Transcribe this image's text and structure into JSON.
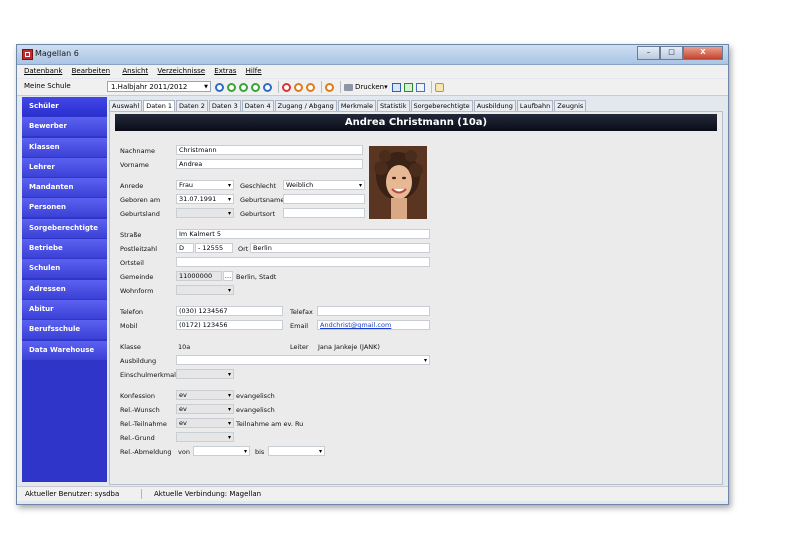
{
  "window": {
    "title": "Magellan 6",
    "controls": [
      "–",
      "□",
      "X"
    ]
  },
  "menu": [
    "Datenbank",
    "Bearbeiten",
    "Ansicht",
    "Verzeichnisse",
    "Extras",
    "Hilfe"
  ],
  "toolbar": {
    "school": "Meine Schule",
    "period": "1.Halbjahr 2011/2012",
    "print_label": "Drucken"
  },
  "sidebar": [
    "Schüler",
    "Bewerber",
    "Klassen",
    "Lehrer",
    "Mandanten",
    "Personen",
    "Sorgeberechtigte",
    "Betriebe",
    "Schulen",
    "Adressen",
    "Abitur",
    "Berufsschule",
    "Data Warehouse"
  ],
  "tabs": [
    "Auswahl",
    "Daten 1",
    "Daten 2",
    "Daten 3",
    "Daten 4",
    "Zugang / Abgang",
    "Merkmale",
    "Statistik",
    "Sorgeberechtigte",
    "Ausbildung",
    "Laufbahn",
    "Zeugnis"
  ],
  "header": "Andrea Christmann (10a)",
  "labels": {
    "nachname": "Nachname",
    "vorname": "Vorname",
    "anrede": "Anrede",
    "geschlecht": "Geschlecht",
    "geboren": "Geboren am",
    "geburtsname": "Geburtsname",
    "geburtsland": "Geburtsland",
    "geburtsort": "Geburtsort",
    "strasse": "Straße",
    "plz": "Postleitzahl",
    "ort": "Ort",
    "ortsteil": "Ortsteil",
    "gemeinde": "Gemeinde",
    "wohnform": "Wohnform",
    "telefon": "Telefon",
    "telefax": "Telefax",
    "mobil": "Mobil",
    "email": "Email",
    "klasse": "Klasse",
    "leiter": "Leiter",
    "ausbildung": "Ausbildung",
    "einschul": "Einschulmerkmal",
    "konfession": "Konfession",
    "relwunsch": "Rel.-Wunsch",
    "relteil": "Rel.-Teilnahme",
    "relgrund": "Rel.-Grund",
    "relabm": "Rel.-Abmeldung",
    "von": "von",
    "bis": "bis"
  },
  "values": {
    "nachname": "Christmann",
    "vorname": "Andrea",
    "anrede": "Frau",
    "geschlecht": "Weiblich",
    "geboren": "31.07.1991",
    "strasse": "Im Kalmert 5",
    "plz_country": "D",
    "plz": "- 12555",
    "ort": "Berlin",
    "gemeinde": "11000000",
    "gemeinde_name": "Berlin, Stadt",
    "telefon": "(030) 1234567",
    "mobil": "(0172) 123456",
    "email": "Andchrist@gmail.com",
    "klasse": "10a",
    "leiter": "Jana Jankeje (JANK)",
    "konfession": "ev",
    "konfession_text": "evangelisch",
    "relwunsch": "ev",
    "relwunsch_text": "evangelisch",
    "relteil": "ev",
    "relteil_text": "Teilnahme am ev. Ru"
  },
  "status": {
    "user": "Aktueller Benutzer: sysdba",
    "connection": "Aktuelle Verbindung: Magellan"
  }
}
